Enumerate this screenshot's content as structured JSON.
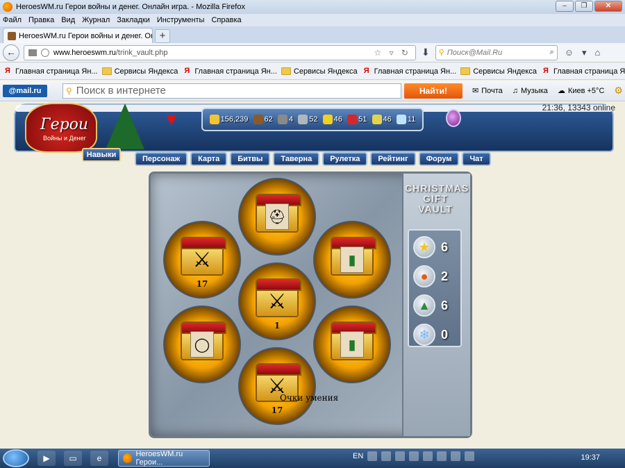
{
  "window": {
    "title": "HeroesWM.ru Герои войны и денег. Онлайн игра. - Mozilla Firefox",
    "minimize": "–",
    "maximize": "❐",
    "close": "✕"
  },
  "menu": [
    "Файл",
    "Правка",
    "Вид",
    "Журнал",
    "Закладки",
    "Инструменты",
    "Справка"
  ],
  "tab": {
    "label": "HeroesWM.ru Герои войны и денег. Он...",
    "new_tab": "+"
  },
  "navbar": {
    "back": "←",
    "url_host": "www.heroeswm.ru",
    "url_path": "/trink_vault.php",
    "url_icons": "☆ ▿ ↻",
    "download": "⬇",
    "search_placeholder": "Поиск@Mail.Ru",
    "search_icon": "⌕",
    "end_icons": [
      "☺",
      "▾",
      "⌂"
    ]
  },
  "bookmarks": [
    {
      "icon": "y",
      "label": "Главная страница Ян..."
    },
    {
      "icon": "folder",
      "label": "Сервисы Яндекса"
    },
    {
      "icon": "y",
      "label": "Главная страница Ян..."
    },
    {
      "icon": "folder",
      "label": "Сервисы Яндекса"
    },
    {
      "icon": "y",
      "label": "Главная страница Ян..."
    },
    {
      "icon": "folder",
      "label": "Сервисы Яндекса"
    },
    {
      "icon": "y",
      "label": "Главная страница Ян..."
    }
  ],
  "bookmarks_more": "»",
  "mailbar": {
    "logo": "@mail.ru",
    "search_placeholder": "Поиск в интернете",
    "find_button": "Найти!",
    "mail": "Почта",
    "music": "Музыка",
    "weather": "Киев +5°C"
  },
  "game": {
    "time_online": "21:36, 13343 online",
    "logo_title": "Герои",
    "logo_subtitle": "Войны и Денег",
    "resources": [
      {
        "name": "gold",
        "value": "156,239",
        "color": "#f4c430"
      },
      {
        "name": "wood",
        "value": "62",
        "color": "#8b5a2b"
      },
      {
        "name": "ore",
        "value": "4",
        "color": "#8a8a8a"
      },
      {
        "name": "mercury",
        "value": "52",
        "color": "#b0b6bd"
      },
      {
        "name": "sulfur",
        "value": "46",
        "color": "#f0d020"
      },
      {
        "name": "crystals",
        "value": "51",
        "color": "#d8252a"
      },
      {
        "name": "gems",
        "value": "46",
        "color": "#e6d24a"
      },
      {
        "name": "diamonds",
        "value": "11",
        "color": "#bfe3ff"
      }
    ],
    "skills_button": "Навыки",
    "nav": [
      "Персонаж",
      "Карта",
      "Битвы",
      "Таверна",
      "Рулетка",
      "Рейтинг",
      "Форум",
      "Чат"
    ]
  },
  "vault": {
    "title": "CHRISTMAS GIFT VAULT",
    "counters": [
      {
        "icon": "star",
        "glyph": "★",
        "value": "6",
        "color": "#f5c518"
      },
      {
        "icon": "ornament",
        "glyph": "●",
        "value": "2",
        "color": "#e85a14"
      },
      {
        "icon": "tree",
        "glyph": "▲",
        "value": "6",
        "color": "#2e8b3a"
      },
      {
        "icon": "snowflake",
        "glyph": "❄",
        "value": "0",
        "color": "#6fb6ff"
      }
    ],
    "slots": [
      {
        "id": "top",
        "item": "helmet",
        "glyph": "⛑",
        "count": ""
      },
      {
        "id": "upper-left",
        "item": "swords",
        "glyph": "⚔",
        "count": "17"
      },
      {
        "id": "upper-right",
        "item": "scroll",
        "glyph": "▮",
        "count": ""
      },
      {
        "id": "center",
        "item": "swords",
        "glyph": "⚔",
        "count": "1"
      },
      {
        "id": "lower-left",
        "item": "ring",
        "glyph": "◯",
        "count": ""
      },
      {
        "id": "lower-right",
        "item": "scroll",
        "glyph": "▮",
        "count": ""
      },
      {
        "id": "bottom",
        "item": "swords",
        "glyph": "⚔",
        "count": "17"
      }
    ],
    "tooltip": "Очки умения"
  },
  "taskbar": {
    "task_label": "HeroesWM.ru Герои...",
    "lang": "EN",
    "clock": "19:37"
  }
}
